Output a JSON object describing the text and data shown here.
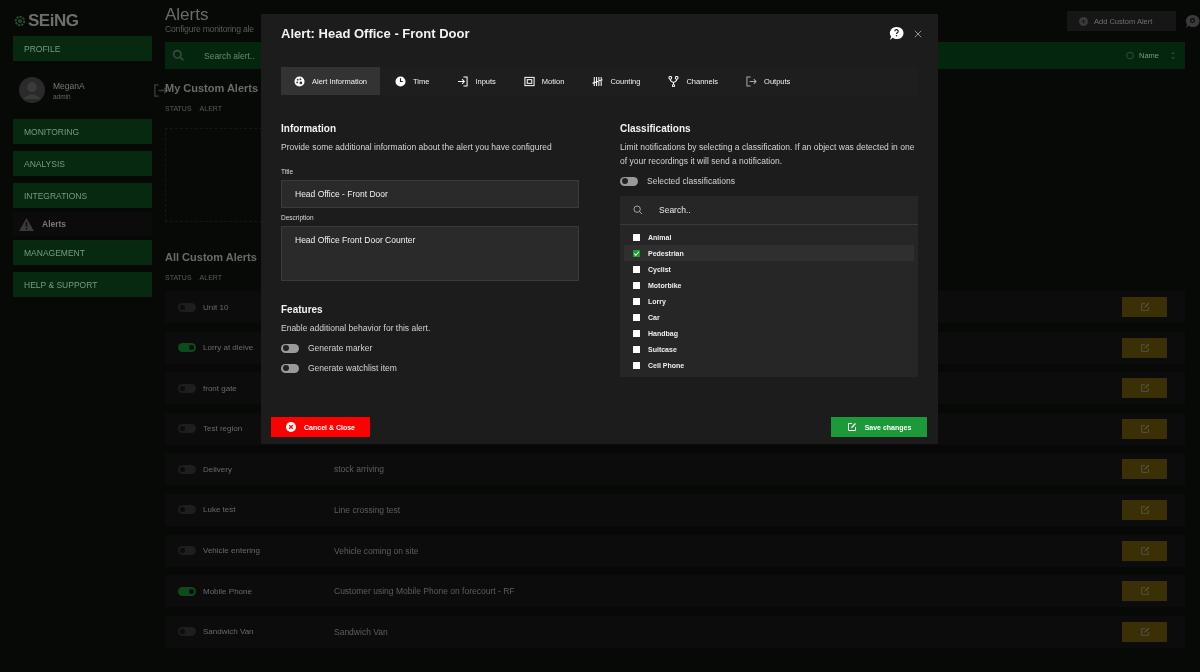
{
  "sidebar": {
    "logo": "SEiNG",
    "profile_button": "PROFILE",
    "user": {
      "name": "MeganA",
      "role": "admin"
    },
    "nav": [
      {
        "label": "MONITORING",
        "kind": "section"
      },
      {
        "label": "ANALYSIS",
        "kind": "section"
      },
      {
        "label": "INTEGRATIONS",
        "kind": "section"
      },
      {
        "label": "Alerts",
        "kind": "link"
      },
      {
        "label": "MANAGEMENT",
        "kind": "section"
      },
      {
        "label": "HELP & SUPPORT",
        "kind": "section"
      }
    ]
  },
  "page": {
    "title": "Alerts",
    "subtitle": "Configure monitoring ale",
    "add_button": "Add Custom Alert",
    "search": {
      "placeholder": "Search alert.."
    },
    "sort_label": "Name"
  },
  "my_alerts": {
    "heading": "My Custom Alerts",
    "columns": [
      "STATUS",
      "ALERT"
    ]
  },
  "all_alerts": {
    "heading": "All Custom Alerts",
    "columns": [
      "STATUS",
      "ALERT"
    ],
    "rows": [
      {
        "name": "Unit 10",
        "on": false
      },
      {
        "name": "Lorry at dleive",
        "on": true
      },
      {
        "name": "front gate",
        "on": false
      },
      {
        "name": "Test region",
        "on": false
      },
      {
        "name": "Delivery",
        "description": "stock arriving",
        "on": false
      },
      {
        "name": "Luke test",
        "description": "Line crossing test",
        "on": false
      },
      {
        "name": "Vehicle entering",
        "description": "Vehicle coming on site",
        "on": false
      },
      {
        "name": "Mobile Phone",
        "description": "Customer using Mobile Phone on forecourt - RF",
        "on": true
      },
      {
        "name": "Sandwich Van",
        "description": "Sandwich Van",
        "on": false
      }
    ]
  },
  "modal": {
    "title": "Alert: Head Office - Front Door",
    "tabs": [
      {
        "label": "Alert Information",
        "selected": true
      },
      {
        "label": "Time",
        "selected": false
      },
      {
        "label": "Inputs",
        "selected": false
      },
      {
        "label": "Motion",
        "selected": false
      },
      {
        "label": "Counting",
        "selected": false
      },
      {
        "label": "Channels",
        "selected": false
      },
      {
        "label": "Outputs",
        "selected": false
      }
    ],
    "information": {
      "heading": "Information",
      "text": "Provide some additional information about the alert you have configured",
      "title_label": "Title",
      "title_value": "Head Office - Front Door",
      "description_label": "Description",
      "description_value": "Head Office Front Door Counter"
    },
    "features": {
      "heading": "Features",
      "text": "Enable additional behavior for this alert.",
      "toggles": [
        {
          "label": "Generate marker",
          "on": false
        },
        {
          "label": "Generate watchlist item",
          "on": false
        }
      ]
    },
    "classifications": {
      "heading": "Classifications",
      "text": "Limit notifications by selecting a classification. If an object was detected in one of your recordings it will send a notification.",
      "toggle": {
        "label": "Selected classifications",
        "on": false
      },
      "search": {
        "placeholder": "Search.."
      },
      "items": [
        {
          "label": "Animal",
          "checked": false
        },
        {
          "label": "Pedestrian",
          "checked": true
        },
        {
          "label": "Cyclist",
          "checked": false
        },
        {
          "label": "Motorbike",
          "checked": false
        },
        {
          "label": "Lorry",
          "checked": false
        },
        {
          "label": "Car",
          "checked": false
        },
        {
          "label": "Handbag",
          "checked": false
        },
        {
          "label": "Suitcase",
          "checked": false
        },
        {
          "label": "Cell Phone",
          "checked": false
        }
      ]
    },
    "cancel_button": "Cancel & Close",
    "save_button": "Save changes"
  }
}
